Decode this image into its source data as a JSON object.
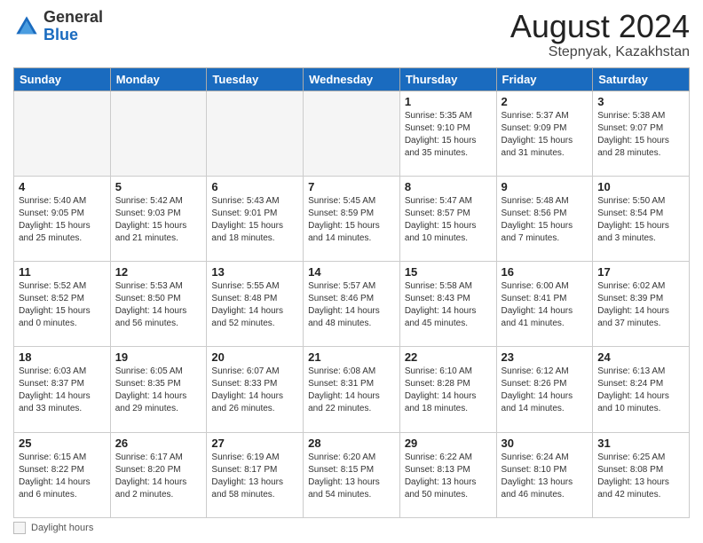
{
  "header": {
    "logo": {
      "line1": "General",
      "line2": "Blue"
    },
    "title": "August 2024",
    "subtitle": "Stepnyak, Kazakhstan"
  },
  "days_of_week": [
    "Sunday",
    "Monday",
    "Tuesday",
    "Wednesday",
    "Thursday",
    "Friday",
    "Saturday"
  ],
  "weeks": [
    [
      {
        "day": "",
        "info": ""
      },
      {
        "day": "",
        "info": ""
      },
      {
        "day": "",
        "info": ""
      },
      {
        "day": "",
        "info": ""
      },
      {
        "day": "1",
        "info": "Sunrise: 5:35 AM\nSunset: 9:10 PM\nDaylight: 15 hours\nand 35 minutes."
      },
      {
        "day": "2",
        "info": "Sunrise: 5:37 AM\nSunset: 9:09 PM\nDaylight: 15 hours\nand 31 minutes."
      },
      {
        "day": "3",
        "info": "Sunrise: 5:38 AM\nSunset: 9:07 PM\nDaylight: 15 hours\nand 28 minutes."
      }
    ],
    [
      {
        "day": "4",
        "info": "Sunrise: 5:40 AM\nSunset: 9:05 PM\nDaylight: 15 hours\nand 25 minutes."
      },
      {
        "day": "5",
        "info": "Sunrise: 5:42 AM\nSunset: 9:03 PM\nDaylight: 15 hours\nand 21 minutes."
      },
      {
        "day": "6",
        "info": "Sunrise: 5:43 AM\nSunset: 9:01 PM\nDaylight: 15 hours\nand 18 minutes."
      },
      {
        "day": "7",
        "info": "Sunrise: 5:45 AM\nSunset: 8:59 PM\nDaylight: 15 hours\nand 14 minutes."
      },
      {
        "day": "8",
        "info": "Sunrise: 5:47 AM\nSunset: 8:57 PM\nDaylight: 15 hours\nand 10 minutes."
      },
      {
        "day": "9",
        "info": "Sunrise: 5:48 AM\nSunset: 8:56 PM\nDaylight: 15 hours\nand 7 minutes."
      },
      {
        "day": "10",
        "info": "Sunrise: 5:50 AM\nSunset: 8:54 PM\nDaylight: 15 hours\nand 3 minutes."
      }
    ],
    [
      {
        "day": "11",
        "info": "Sunrise: 5:52 AM\nSunset: 8:52 PM\nDaylight: 15 hours\nand 0 minutes."
      },
      {
        "day": "12",
        "info": "Sunrise: 5:53 AM\nSunset: 8:50 PM\nDaylight: 14 hours\nand 56 minutes."
      },
      {
        "day": "13",
        "info": "Sunrise: 5:55 AM\nSunset: 8:48 PM\nDaylight: 14 hours\nand 52 minutes."
      },
      {
        "day": "14",
        "info": "Sunrise: 5:57 AM\nSunset: 8:46 PM\nDaylight: 14 hours\nand 48 minutes."
      },
      {
        "day": "15",
        "info": "Sunrise: 5:58 AM\nSunset: 8:43 PM\nDaylight: 14 hours\nand 45 minutes."
      },
      {
        "day": "16",
        "info": "Sunrise: 6:00 AM\nSunset: 8:41 PM\nDaylight: 14 hours\nand 41 minutes."
      },
      {
        "day": "17",
        "info": "Sunrise: 6:02 AM\nSunset: 8:39 PM\nDaylight: 14 hours\nand 37 minutes."
      }
    ],
    [
      {
        "day": "18",
        "info": "Sunrise: 6:03 AM\nSunset: 8:37 PM\nDaylight: 14 hours\nand 33 minutes."
      },
      {
        "day": "19",
        "info": "Sunrise: 6:05 AM\nSunset: 8:35 PM\nDaylight: 14 hours\nand 29 minutes."
      },
      {
        "day": "20",
        "info": "Sunrise: 6:07 AM\nSunset: 8:33 PM\nDaylight: 14 hours\nand 26 minutes."
      },
      {
        "day": "21",
        "info": "Sunrise: 6:08 AM\nSunset: 8:31 PM\nDaylight: 14 hours\nand 22 minutes."
      },
      {
        "day": "22",
        "info": "Sunrise: 6:10 AM\nSunset: 8:28 PM\nDaylight: 14 hours\nand 18 minutes."
      },
      {
        "day": "23",
        "info": "Sunrise: 6:12 AM\nSunset: 8:26 PM\nDaylight: 14 hours\nand 14 minutes."
      },
      {
        "day": "24",
        "info": "Sunrise: 6:13 AM\nSunset: 8:24 PM\nDaylight: 14 hours\nand 10 minutes."
      }
    ],
    [
      {
        "day": "25",
        "info": "Sunrise: 6:15 AM\nSunset: 8:22 PM\nDaylight: 14 hours\nand 6 minutes."
      },
      {
        "day": "26",
        "info": "Sunrise: 6:17 AM\nSunset: 8:20 PM\nDaylight: 14 hours\nand 2 minutes."
      },
      {
        "day": "27",
        "info": "Sunrise: 6:19 AM\nSunset: 8:17 PM\nDaylight: 13 hours\nand 58 minutes."
      },
      {
        "day": "28",
        "info": "Sunrise: 6:20 AM\nSunset: 8:15 PM\nDaylight: 13 hours\nand 54 minutes."
      },
      {
        "day": "29",
        "info": "Sunrise: 6:22 AM\nSunset: 8:13 PM\nDaylight: 13 hours\nand 50 minutes."
      },
      {
        "day": "30",
        "info": "Sunrise: 6:24 AM\nSunset: 8:10 PM\nDaylight: 13 hours\nand 46 minutes."
      },
      {
        "day": "31",
        "info": "Sunrise: 6:25 AM\nSunset: 8:08 PM\nDaylight: 13 hours\nand 42 minutes."
      }
    ]
  ],
  "footer": {
    "daylight_label": "Daylight hours"
  }
}
